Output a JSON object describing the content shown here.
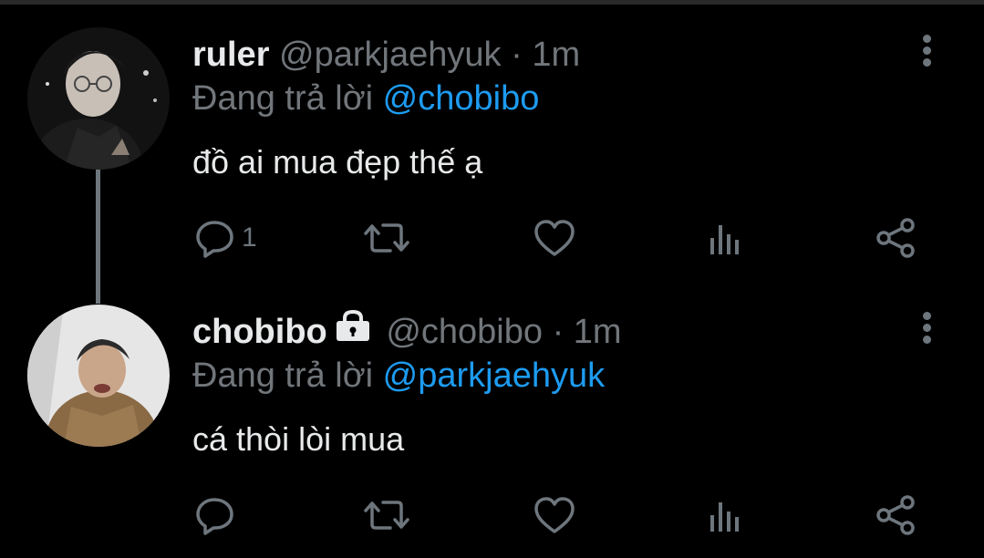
{
  "colors": {
    "background": "#000000",
    "text": "#e7e9ea",
    "muted": "#71767b",
    "accent": "#1d9bf0"
  },
  "tweets": [
    {
      "name": "ruler",
      "handle": "@parkjaehyuk",
      "separator": "·",
      "time": "1m",
      "locked": false,
      "reply_prefix": "Đang trả lời",
      "reply_to": "@chobibo",
      "text": "đồ ai mua đẹp thế ạ",
      "reply_count": "1",
      "icons": [
        "reply-icon",
        "retweet-icon",
        "like-icon",
        "analytics-icon",
        "share-icon",
        "more-icon"
      ]
    },
    {
      "name": "chobibo",
      "handle": "@chobibo",
      "separator": "·",
      "time": "1m",
      "locked": true,
      "reply_prefix": "Đang trả lời",
      "reply_to": "@parkjaehyuk",
      "text": "cá thòi lòi mua",
      "reply_count": "",
      "icons": [
        "reply-icon",
        "retweet-icon",
        "like-icon",
        "analytics-icon",
        "share-icon",
        "more-icon",
        "lock-icon"
      ]
    }
  ]
}
